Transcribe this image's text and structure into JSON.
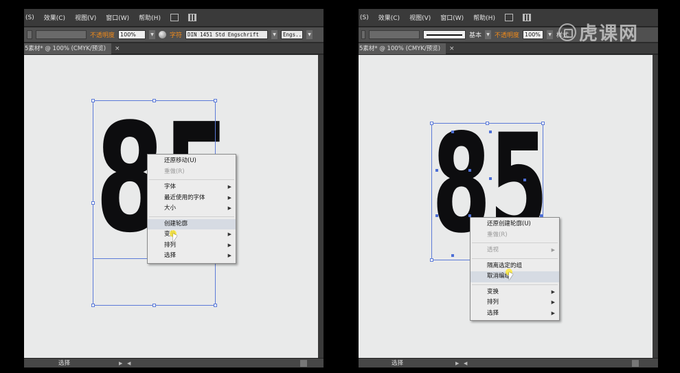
{
  "left": {
    "menubar": {
      "items": [
        "(S)",
        "效果(C)",
        "视图(V)",
        "窗口(W)",
        "帮助(H)"
      ]
    },
    "controlbar": {
      "opacity_label": "不透明度",
      "opacity_value": "100%",
      "char_label": "字符",
      "font_value": "DIN 1451 Std Engschrift",
      "style_value": "Engs.."
    },
    "tab": {
      "title": "5素材* @ 100% (CMYK/预览)",
      "close": "×"
    },
    "canvas": {
      "number_text": "85"
    },
    "context_menu": {
      "items": [
        {
          "label": "还原移动(U)",
          "disabled": false,
          "submenu": false
        },
        {
          "label": "重做(R)",
          "disabled": true,
          "submenu": false
        },
        {
          "sep": true
        },
        {
          "label": "字体",
          "disabled": false,
          "submenu": true
        },
        {
          "label": "最近使用的字体",
          "disabled": false,
          "submenu": true
        },
        {
          "label": "大小",
          "disabled": false,
          "submenu": true
        },
        {
          "sep": true
        },
        {
          "label": "创建轮廓",
          "disabled": false,
          "submenu": false,
          "hover": true
        },
        {
          "label": "变换",
          "disabled": false,
          "submenu": true
        },
        {
          "label": "排列",
          "disabled": false,
          "submenu": true
        },
        {
          "label": "选择",
          "disabled": false,
          "submenu": true
        }
      ]
    },
    "statusbar": {
      "text": "选择"
    }
  },
  "right": {
    "menubar": {
      "items": [
        "(S)",
        "效果(C)",
        "视图(V)",
        "窗口(W)",
        "帮助(H)"
      ]
    },
    "controlbar": {
      "stroke_label": "基本",
      "opacity_label": "不透明度",
      "opacity_value": "100%",
      "extra_label": "样式"
    },
    "tab": {
      "title": "5素材* @ 100% (CMYK/预览)",
      "close": "×"
    },
    "canvas": {
      "number_text": "85"
    },
    "context_menu": {
      "items": [
        {
          "label": "还原创建轮廓(U)",
          "disabled": false,
          "submenu": false
        },
        {
          "label": "重做(R)",
          "disabled": true,
          "submenu": false
        },
        {
          "sep": true
        },
        {
          "label": "透视",
          "disabled": true,
          "submenu": true
        },
        {
          "sep": true
        },
        {
          "label": "隔离选定的组",
          "disabled": false,
          "submenu": false
        },
        {
          "label": "取消编组",
          "disabled": false,
          "submenu": false,
          "hover": true
        },
        {
          "sep": true
        },
        {
          "label": "变换",
          "disabled": false,
          "submenu": true
        },
        {
          "label": "排列",
          "disabled": false,
          "submenu": true
        },
        {
          "label": "选择",
          "disabled": false,
          "submenu": true
        }
      ]
    },
    "statusbar": {
      "text": "选择"
    }
  },
  "watermark": {
    "text": "虎课网",
    "icon": "tiger-logo-icon"
  },
  "colors": {
    "selection": "#5b7ad8",
    "glyph": "#0d0d0f",
    "artboard": "#e9eaea",
    "opacity_label": "#f08a1a"
  }
}
